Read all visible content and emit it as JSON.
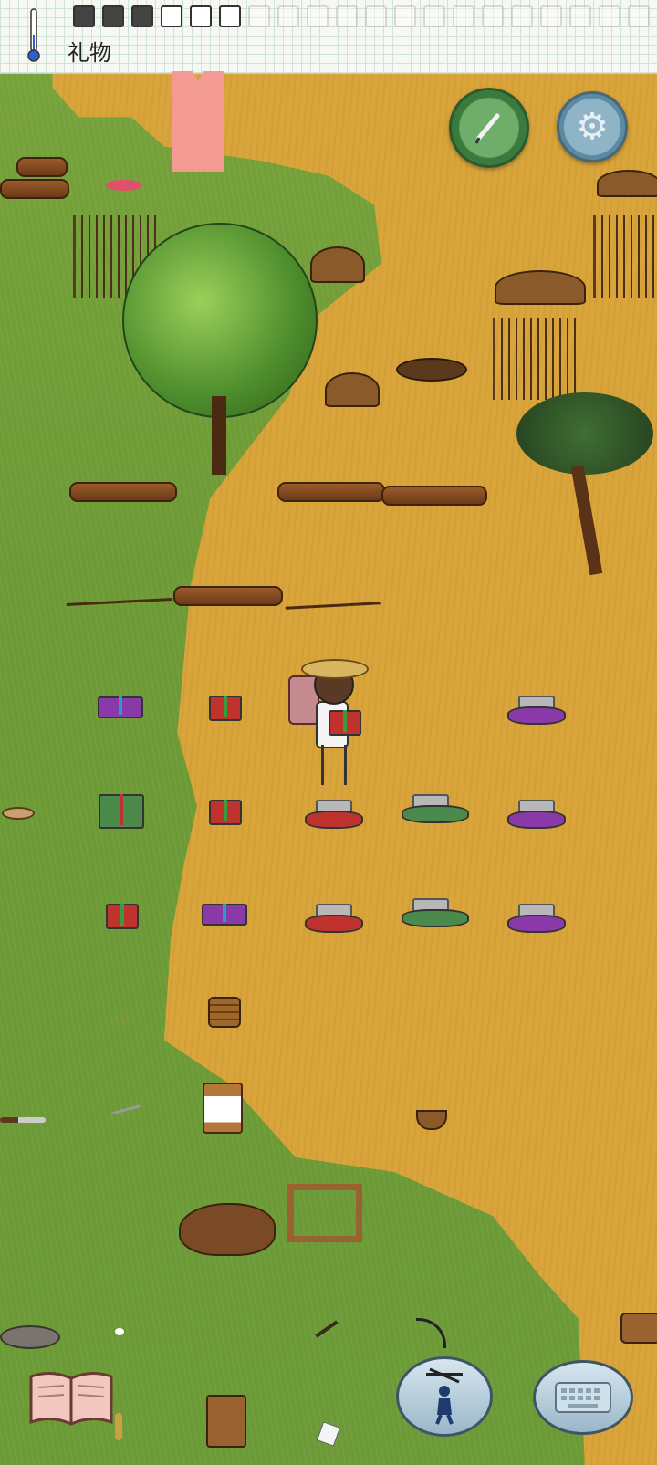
{
  "topbar": {
    "held_item_label": "礼物",
    "temperature_icon": "thermometer-icon",
    "hunger_slots": [
      "filled",
      "filled",
      "filled",
      "empty",
      "empty",
      "empty",
      "faint",
      "faint",
      "faint",
      "faint",
      "faint",
      "faint",
      "faint",
      "faint",
      "faint",
      "faint",
      "faint",
      "faint",
      "faint",
      "faint"
    ]
  },
  "buttons": {
    "compass_icon": "compass-pen-icon",
    "settings_icon": "gear-icon",
    "book_icon": "open-book-icon",
    "puppet_icon": "puppet-icon",
    "keyboard_icon": "keyboard-icon"
  },
  "colors": {
    "grass": "#6d9a35",
    "dry_ground": "#d9a53b",
    "pink_tag": "#f39b92",
    "gift_red": "#c0322e",
    "gift_purple": "#8a3aa8",
    "gift_green": "#4b8a4b"
  }
}
